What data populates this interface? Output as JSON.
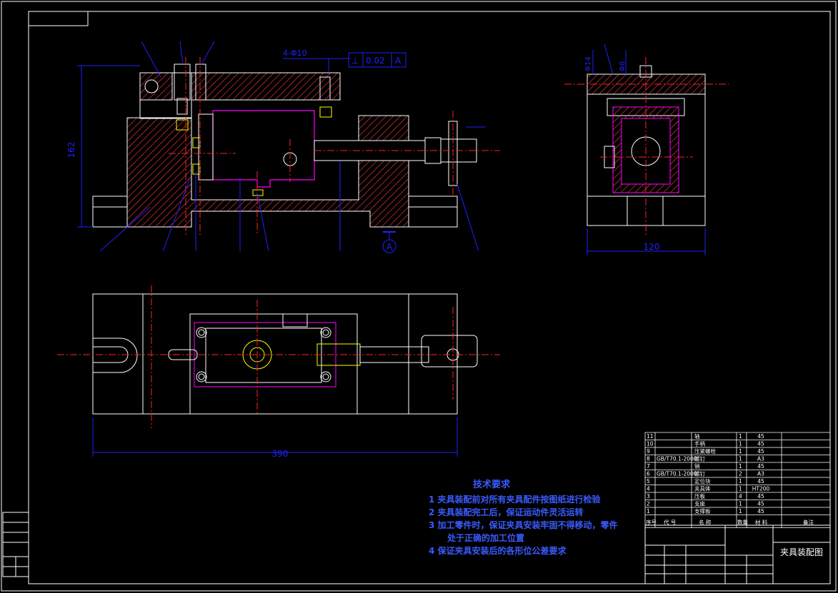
{
  "dimensions": {
    "height_162": "162",
    "width_120": "120",
    "length_390": "390",
    "hole_spec": "4-Φ10",
    "tolerance_symbol": "⊥",
    "tolerance_value": "0.02",
    "datum": "A",
    "datum_marker": "A",
    "side_dim_1": "Φ14",
    "side_dim_2": "Φ8"
  },
  "tech_requirements": {
    "title": "技术要求",
    "lines": [
      "1  夹具装配前对所有夹具配件按图纸进行检验",
      "2  夹具装配完工后，保证运动件灵活运转",
      "3  加工零件时，保证夹具安装牢固不得移动，零件",
      "处于正确的加工位置",
      "4  保证夹具安装后的各形位公差要求"
    ]
  },
  "parts_list": {
    "header": {
      "no": "序号",
      "code": "代  号",
      "name": "名  称",
      "qty": "数量",
      "material": "材  料",
      "remark": "备注"
    },
    "rows": [
      {
        "no": "11",
        "code": "",
        "name": "轴",
        "qty": "1",
        "material": "45"
      },
      {
        "no": "10",
        "code": "",
        "name": "手柄",
        "qty": "1",
        "material": "45"
      },
      {
        "no": "9",
        "code": "",
        "name": "压紧螺栓",
        "qty": "1",
        "material": "45"
      },
      {
        "no": "8",
        "code": "GB/T70.1-2000",
        "name": "螺钉",
        "qty": "1",
        "material": "A3"
      },
      {
        "no": "7",
        "code": "",
        "name": "销",
        "qty": "1",
        "material": "45"
      },
      {
        "no": "6",
        "code": "GB/T70.1-2000",
        "name": "螺钉",
        "qty": "2",
        "material": "A3"
      },
      {
        "no": "5",
        "code": "",
        "name": "定位块",
        "qty": "1",
        "material": "45"
      },
      {
        "no": "4",
        "code": "",
        "name": "夹具体",
        "qty": "1",
        "material": "HT200"
      },
      {
        "no": "3",
        "code": "",
        "name": "压板",
        "qty": "4",
        "material": "45"
      },
      {
        "no": "2",
        "code": "",
        "name": "支座",
        "qty": "1",
        "material": "45"
      },
      {
        "no": "1",
        "code": "",
        "name": "支撑板",
        "qty": "1",
        "material": "45"
      }
    ]
  },
  "title_block": {
    "drawing_title": "夹具装配图"
  },
  "colors": {
    "outline": "#ffffff",
    "hatch": "#ff4040",
    "cavity": "#ff00ff",
    "dimension": "#2020ff",
    "centerline": "#ff2020",
    "yellow": "#ffff00",
    "tech_text": "#3b5bff"
  }
}
